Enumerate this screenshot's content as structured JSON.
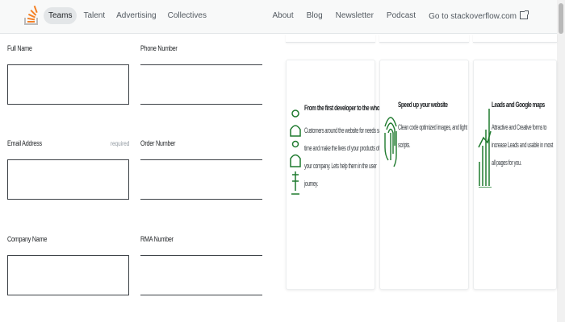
{
  "header": {
    "nav_left": [
      "Teams",
      "Talent",
      "Advertising",
      "Collectives"
    ],
    "active_item": "Teams",
    "nav_right": [
      "About",
      "Blog",
      "Newsletter",
      "Podcast",
      "Go to stackoverflow.com"
    ],
    "brand_color": "#f48024"
  },
  "form": {
    "full_name_label": "Full Name",
    "phone_label": "Phone Number",
    "email_label": "Email Address",
    "required_text": "required",
    "order_label": "Order Number",
    "company_label": "Company Name",
    "rma_label": "RMA Number"
  },
  "cards": [
    {
      "icon": "users-icon",
      "title": "From the first developer to the whole",
      "body": "Customers around the website for needs save time and make the lives of your products of the your company. Lets help them in the user journey."
    },
    {
      "icon": "fingerprint-icon",
      "title": "Speed up your website",
      "body": "Clean code optimized images, and light scripts."
    },
    {
      "icon": "bar-chart-icon",
      "title": "Leads and Google maps",
      "body": "Attractive and Creative forms to increase Leads and usable in most all pages for you."
    }
  ],
  "colors": {
    "accent_green": "#1f7a2e"
  }
}
